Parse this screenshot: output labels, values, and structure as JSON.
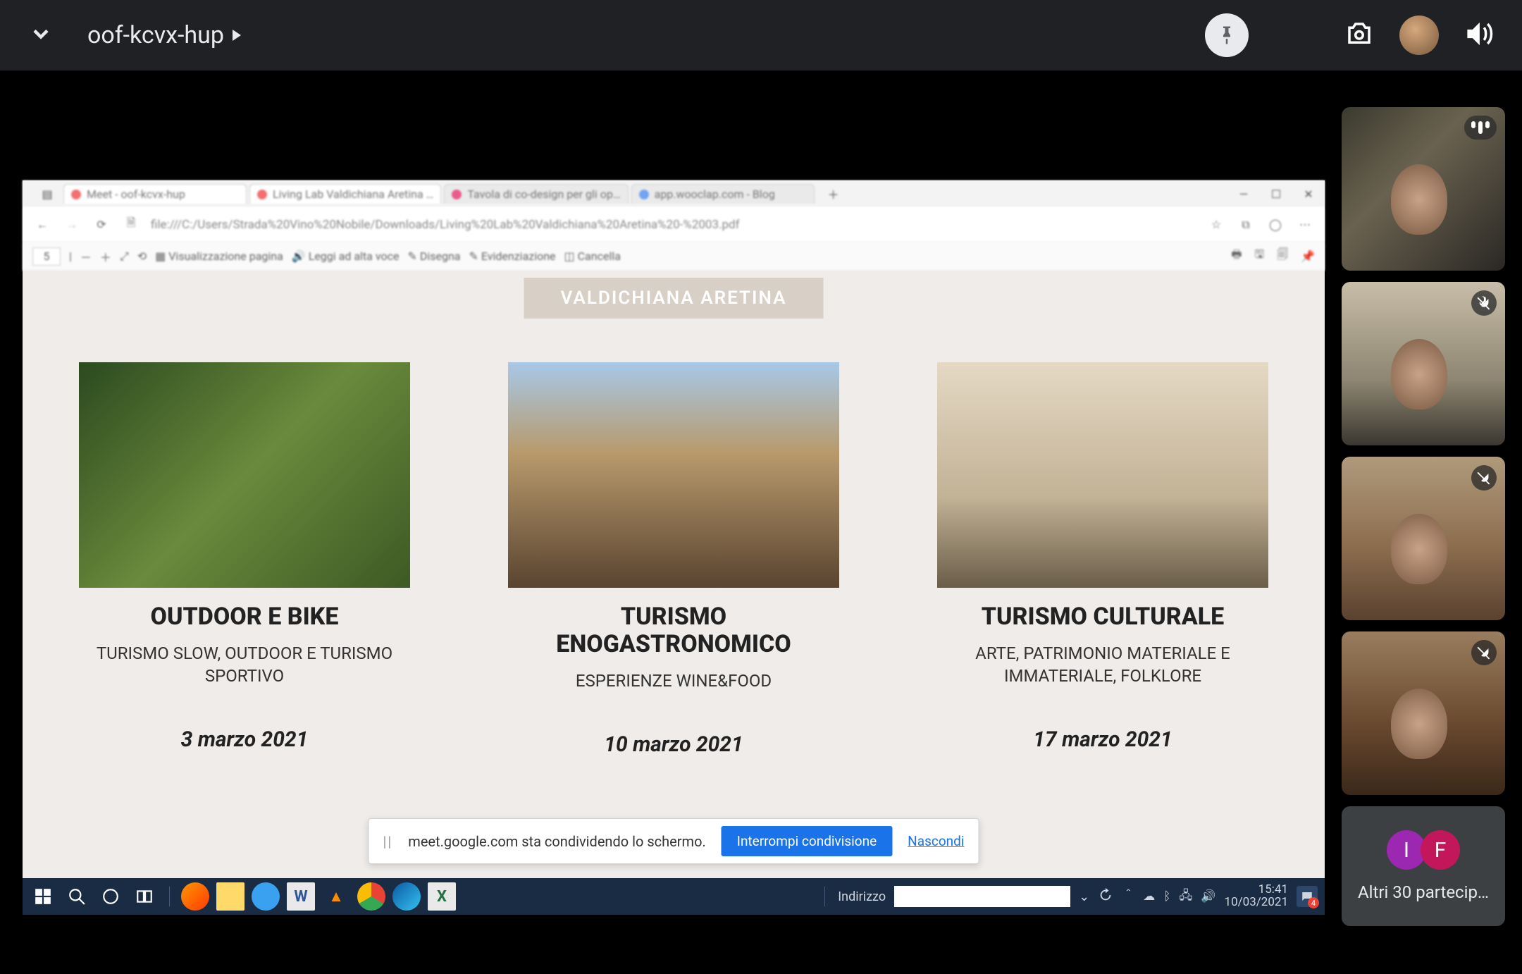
{
  "meet": {
    "meeting_name": "oof-kcvx-hup",
    "others_label": "Altri 30 partecip…",
    "avatar_initials": [
      "I",
      "F"
    ]
  },
  "browser": {
    "tabs": [
      "Meet - oof-kcvx-hup",
      "Living Lab Valdichiana Aretina …",
      "Tavola di co-design per gli op…",
      "app.wooclap.com - Blog"
    ],
    "url": "file:///C:/Users/Strada%20Vino%20Nobile/Downloads/Living%20Lab%20Valdichiana%20Aretina%20-%2003.pdf",
    "page_number": "5"
  },
  "pdf": {
    "region": "VALDICHIANA ARETINA",
    "cards": [
      {
        "title": "OUTDOOR E BIKE",
        "subtitle": "TURISMO SLOW, OUTDOOR E TURISMO SPORTIVO",
        "date": "3 marzo 2021"
      },
      {
        "title": "TURISMO ENOGASTRONOMICO",
        "subtitle": "ESPERIENZE WINE&FOOD",
        "date": "10 marzo 2021"
      },
      {
        "title": "TURISMO CULTURALE",
        "subtitle": "ARTE, PATRIMONIO MATERIALE E IMMATERIALE,  FOLKLORE",
        "date": "17 marzo 2021"
      }
    ]
  },
  "share_banner": {
    "text": "meet.google.com sta condividendo lo schermo.",
    "stop": "Interrompi condivisione",
    "hide": "Nascondi"
  },
  "taskbar": {
    "address_label": "Indirizzo",
    "time": "15:41",
    "date": "10/03/2021",
    "notif_count": "4"
  }
}
